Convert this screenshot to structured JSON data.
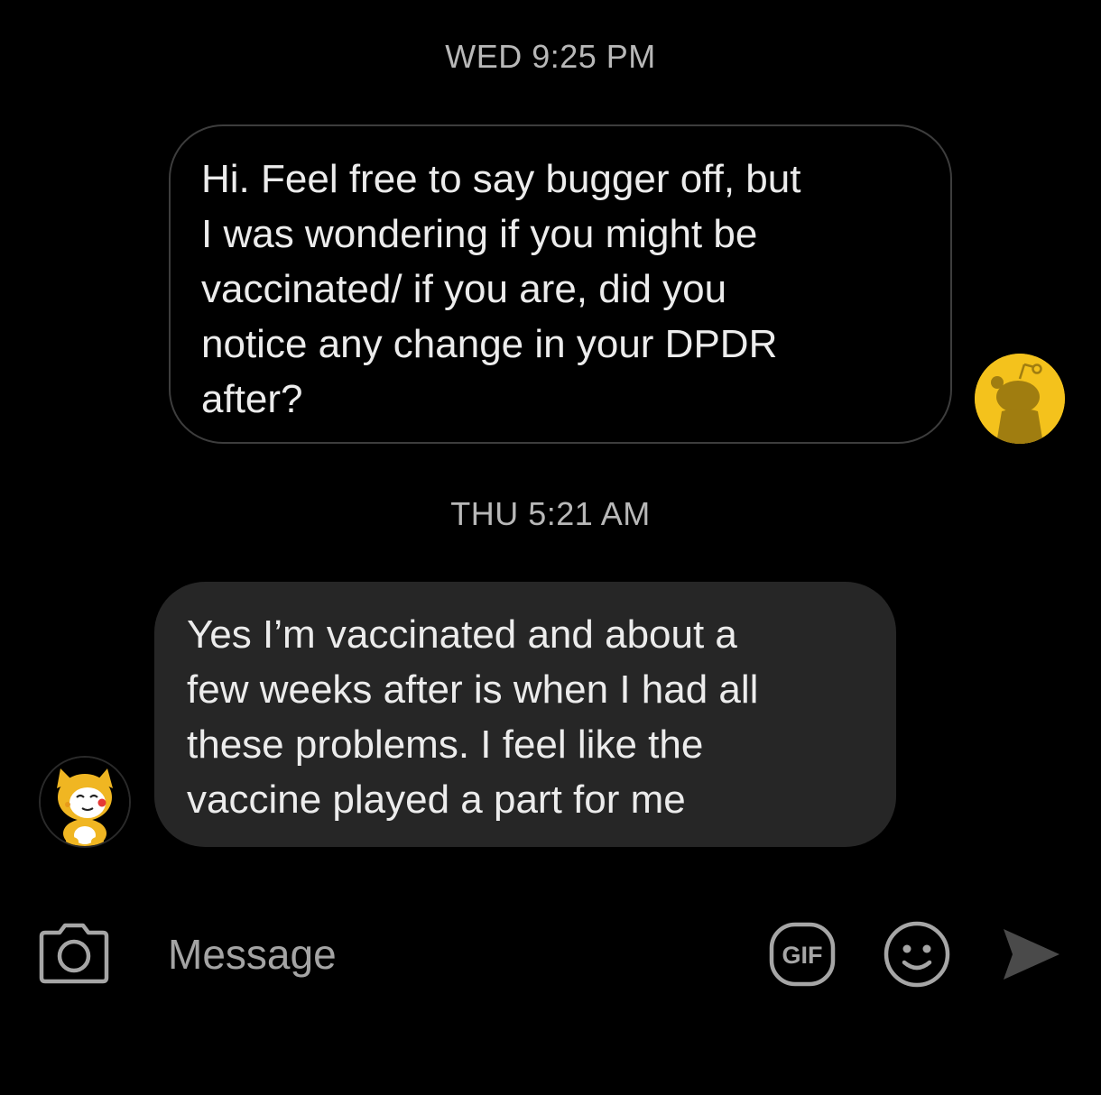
{
  "conversation": {
    "messages": [
      {
        "timestamp": "WED 9:25 PM",
        "direction": "outgoing",
        "text": "Hi. Feel free to say bugger off, but\nI was wondering if you might be\nvaccinated/ if you are, did you\nnotice any change in your DPDR\nafter?"
      },
      {
        "timestamp": "THU 5:21 AM",
        "direction": "incoming",
        "text": "Yes I’m vaccinated and about a\nfew weeks after is when I had all\nthese problems. I feel like the\nvaccine played a part for me"
      }
    ]
  },
  "composer": {
    "placeholder": "Message",
    "gif_label": "GIF",
    "icons": [
      "camera-icon",
      "gif-icon",
      "emoji-icon",
      "send-icon"
    ]
  },
  "colors": {
    "background": "#000000",
    "incoming_bubble": "#262626",
    "outgoing_border": "#3d3d3d",
    "self_avatar": "#f4c21c",
    "icon_gray": "#a6a6a6",
    "send_icon": "#4a4a4a"
  }
}
